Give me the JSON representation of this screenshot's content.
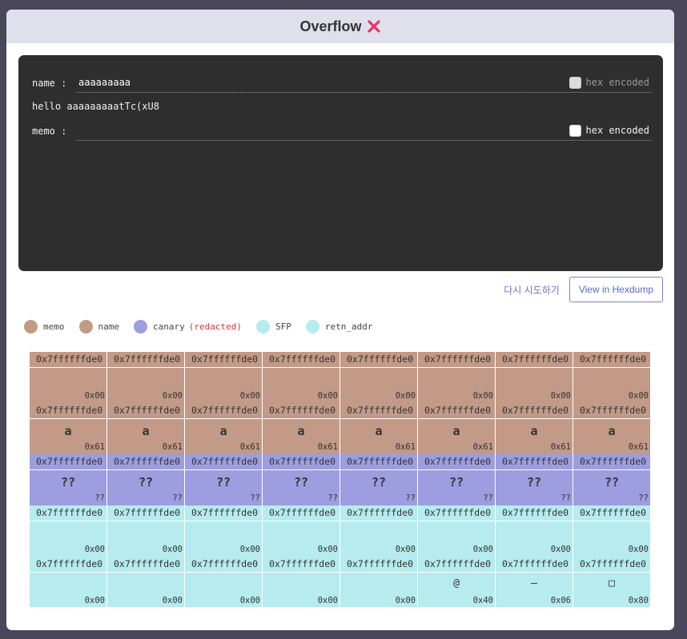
{
  "header": {
    "title": "Overflow",
    "status_icon": "x-icon",
    "status_color": "#e8336a"
  },
  "terminal": {
    "name_label": "name :",
    "name_value": "aaaaaaaaa",
    "name_hex_label": "hex encoded",
    "hello_text": "hello aaaaaaaaatTc(xU8",
    "memo_label": "memo :",
    "memo_value": "",
    "memo_hex_label": "hex encoded"
  },
  "actions": {
    "retry_label": "다시 시도하기",
    "hexdump_label": "View in Hexdump"
  },
  "legend": [
    {
      "label": "memo",
      "color": "#c29a87",
      "note": ""
    },
    {
      "label": "name",
      "color": "#c29a87",
      "note": ""
    },
    {
      "label": "canary",
      "color": "#9d9de0",
      "note": "(redacted)"
    },
    {
      "label": "SFP",
      "color": "#b6ebef",
      "note": ""
    },
    {
      "label": "retn_addr",
      "color": "#b6ebef",
      "note": ""
    }
  ],
  "memory_rows": [
    {
      "kind": "memo",
      "cells": [
        {
          "addr": "0x7ffffffde0",
          "ch": "",
          "hex": "0x00"
        },
        {
          "addr": "0x7ffffffde0",
          "ch": "",
          "hex": "0x00"
        },
        {
          "addr": "0x7ffffffde0",
          "ch": "",
          "hex": "0x00"
        },
        {
          "addr": "0x7ffffffde0",
          "ch": "",
          "hex": "0x00"
        },
        {
          "addr": "0x7ffffffde0",
          "ch": "",
          "hex": "0x00"
        },
        {
          "addr": "0x7ffffffde0",
          "ch": "",
          "hex": "0x00"
        },
        {
          "addr": "0x7ffffffde0",
          "ch": "",
          "hex": "0x00"
        },
        {
          "addr": "0x7ffffffde0",
          "ch": "",
          "hex": "0x00"
        }
      ]
    },
    {
      "kind": "name",
      "cells": [
        {
          "addr": "0x7ffffffde0",
          "ch": "a",
          "hex": "0x61"
        },
        {
          "addr": "0x7ffffffde0",
          "ch": "a",
          "hex": "0x61"
        },
        {
          "addr": "0x7ffffffde0",
          "ch": "a",
          "hex": "0x61"
        },
        {
          "addr": "0x7ffffffde0",
          "ch": "a",
          "hex": "0x61"
        },
        {
          "addr": "0x7ffffffde0",
          "ch": "a",
          "hex": "0x61"
        },
        {
          "addr": "0x7ffffffde0",
          "ch": "a",
          "hex": "0x61"
        },
        {
          "addr": "0x7ffffffde0",
          "ch": "a",
          "hex": "0x61"
        },
        {
          "addr": "0x7ffffffde0",
          "ch": "a",
          "hex": "0x61"
        }
      ]
    },
    {
      "kind": "canary",
      "cells": [
        {
          "addr": "0x7ffffffde0",
          "ch": "??",
          "hex": "??"
        },
        {
          "addr": "0x7ffffffde0",
          "ch": "??",
          "hex": "??"
        },
        {
          "addr": "0x7ffffffde0",
          "ch": "??",
          "hex": "??"
        },
        {
          "addr": "0x7ffffffde0",
          "ch": "??",
          "hex": "??"
        },
        {
          "addr": "0x7ffffffde0",
          "ch": "??",
          "hex": "??"
        },
        {
          "addr": "0x7ffffffde0",
          "ch": "??",
          "hex": "??"
        },
        {
          "addr": "0x7ffffffde0",
          "ch": "??",
          "hex": "??"
        },
        {
          "addr": "0x7ffffffde0",
          "ch": "??",
          "hex": "??"
        }
      ]
    },
    {
      "kind": "sfp",
      "cells": [
        {
          "addr": "0x7ffffffde0",
          "ch": "",
          "hex": "0x00"
        },
        {
          "addr": "0x7ffffffde0",
          "ch": "",
          "hex": "0x00"
        },
        {
          "addr": "0x7ffffffde0",
          "ch": "",
          "hex": "0x00"
        },
        {
          "addr": "0x7ffffffde0",
          "ch": "",
          "hex": "0x00"
        },
        {
          "addr": "0x7ffffffde0",
          "ch": "",
          "hex": "0x00"
        },
        {
          "addr": "0x7ffffffde0",
          "ch": "",
          "hex": "0x00"
        },
        {
          "addr": "0x7ffffffde0",
          "ch": "",
          "hex": "0x00"
        },
        {
          "addr": "0x7ffffffde0",
          "ch": "",
          "hex": "0x00"
        }
      ]
    },
    {
      "kind": "retn",
      "cells": [
        {
          "addr": "0x7ffffffde0",
          "ch": "",
          "hex": "0x00"
        },
        {
          "addr": "0x7ffffffde0",
          "ch": "",
          "hex": "0x00"
        },
        {
          "addr": "0x7ffffffde0",
          "ch": "",
          "hex": "0x00"
        },
        {
          "addr": "0x7ffffffde0",
          "ch": "",
          "hex": "0x00"
        },
        {
          "addr": "0x7ffffffde0",
          "ch": "",
          "hex": "0x00"
        },
        {
          "addr": "0x7ffffffde0",
          "ch": "@",
          "hex": "0x40"
        },
        {
          "addr": "0x7ffffffde0",
          "ch": "—",
          "hex": "0x06"
        },
        {
          "addr": "0x7ffffffde0",
          "ch": "□",
          "hex": "0x80"
        }
      ]
    }
  ]
}
